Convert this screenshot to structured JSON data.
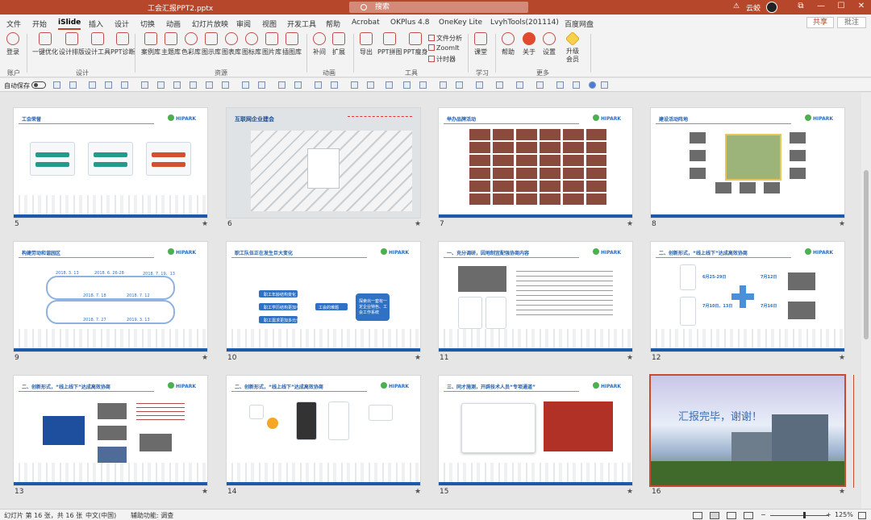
{
  "window": {
    "file_name": "工会汇报PPT2.pptx",
    "search_placeholder": "搜索",
    "user_name": "云蛟",
    "warning_icon": "⚠",
    "min_btn": "—",
    "max_btn": "☐",
    "close_btn": "✕",
    "ribbon_opts": "⧉"
  },
  "menu": {
    "tabs": [
      "文件",
      "开始",
      "iSlide",
      "插入",
      "设计",
      "切换",
      "动画",
      "幻灯片放映",
      "审阅",
      "视图",
      "开发工具",
      "帮助",
      "Acrobat",
      "OKPlus 4.8",
      "OneKey Lite",
      "LvyhTools(201114)",
      "百度网盘"
    ],
    "active_tab": "iSlide",
    "share": "共享",
    "comment": "批注"
  },
  "ribbon": {
    "buttons": {
      "login": "登录",
      "one_key_opt": "一键优化",
      "design_layout": "设计排版",
      "design_tools": "设计工具",
      "ppt_diag": "PPT诊断",
      "case_lib": "案例库",
      "theme_lib": "主题库",
      "color_lib": "色彩库",
      "icon_lib": "图示库",
      "chart_lib": "图表库",
      "glyph_lib": "图标库",
      "picture_lib": "图片库",
      "illus_lib": "插图库",
      "tween": "补间",
      "extend": "扩展",
      "export": "导出",
      "ppt_tile": "PPT拼图",
      "ppt_thin": "PPT瘦身",
      "file_analysis": "文件分析",
      "zoomit": "ZoomIt",
      "timer": "计时器",
      "classroom": "课堂",
      "help": "帮助",
      "about": "关于",
      "settings": "设置",
      "upgrade": "升级",
      "member": "会员"
    },
    "groups": {
      "account": "账户",
      "design": "设计",
      "resources": "资源",
      "animation": "动画",
      "tools": "工具",
      "learn": "学习",
      "more": "更多"
    }
  },
  "qat": {
    "autosave": "自动保存"
  },
  "slides": [
    {
      "n": "5",
      "title": "工会荣誉"
    },
    {
      "n": "6",
      "title": "互联网企业建会"
    },
    {
      "n": "7",
      "title": "举办品牌活动"
    },
    {
      "n": "8",
      "title": "建设活动阵地"
    },
    {
      "n": "9",
      "title": "构建劳动和谐园区"
    },
    {
      "n": "10",
      "title": "职工队伍正在发生巨大变化"
    },
    {
      "n": "11",
      "title": "一、充分调研，因地制宜配强协商内容"
    },
    {
      "n": "12",
      "title": "二、创新形式，“线上线下”达成高效协商"
    },
    {
      "n": "13",
      "title": "二、创新形式，“线上线下”达成高效协商"
    },
    {
      "n": "14",
      "title": "二、创新形式，“线上线下”达成高效协商"
    },
    {
      "n": "15",
      "title": "三、同才施测，开辟技术人员“专项通道”"
    },
    {
      "n": "16",
      "title": "汇报完毕，谢谢！"
    }
  ],
  "slide_text": {
    "logo": "HIPARK",
    "s9_dates": [
      "2018. 3. 13",
      "2018. 6. 26-28",
      "2018. 7. 19、13",
      "2018. 7. 18",
      "2018. 7. 12",
      "2018. 7. 27",
      "2019. 3. 13"
    ],
    "s10_items": [
      "职工年龄结构变化",
      "职工学历结构更加丰富",
      "职工需求更加多元化"
    ],
    "s10_center": "工会的难题",
    "s10_right": "探索出一套有一定企业特色、工会工作系统",
    "s12_a": "6月25-29日",
    "s12_b": "7月12日",
    "s12_c": "7月10日、13日",
    "s12_d": "7月16日"
  },
  "status": {
    "slide_info": "幻灯片 第 16 张，共 16 张",
    "lang": "中文(中国)",
    "accessibility": "辅助功能: 调查",
    "zoom": "125%"
  },
  "colors": {
    "brand": "#b7472a",
    "slide_blue": "#1f5fb0",
    "selection": "#c64b2f"
  }
}
